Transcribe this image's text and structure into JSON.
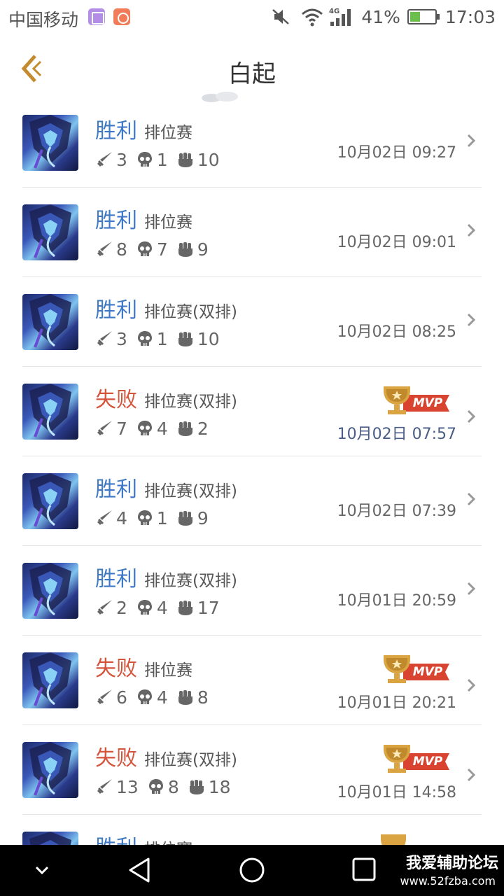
{
  "status_bar": {
    "carrier": "中国移动",
    "network": "4G",
    "battery": "41%",
    "battery_level": 0.41,
    "time": "17:03",
    "icons": [
      "gallery-icon",
      "rocket-icon",
      "mute-icon",
      "wifi-icon",
      "signal-icon",
      "battery-icon"
    ]
  },
  "header": {
    "title": "白起",
    "back_icon": "back-arrow-icon"
  },
  "colors": {
    "win": "#3f79c6",
    "loss": "#d4543c",
    "mvp_gold": "#d9a441",
    "mvp_red": "#d94431",
    "divider": "#e3e3e3"
  },
  "matches": [
    {
      "result": "胜利",
      "type": "win",
      "mode": "排位赛",
      "kills": "3",
      "deaths": "1",
      "assists": "10",
      "time": "10月02日 09:27",
      "mvp": false
    },
    {
      "result": "胜利",
      "type": "win",
      "mode": "排位赛",
      "kills": "8",
      "deaths": "7",
      "assists": "9",
      "time": "10月02日 09:01",
      "mvp": false
    },
    {
      "result": "胜利",
      "type": "win",
      "mode": "排位赛(双排)",
      "kills": "3",
      "deaths": "1",
      "assists": "10",
      "time": "10月02日 08:25",
      "mvp": false
    },
    {
      "result": "失败",
      "type": "loss",
      "mode": "排位赛(双排)",
      "kills": "7",
      "deaths": "4",
      "assists": "2",
      "time": "10月02日 07:57",
      "mvp": true,
      "mvp_label": "MVP"
    },
    {
      "result": "胜利",
      "type": "win",
      "mode": "排位赛(双排)",
      "kills": "4",
      "deaths": "1",
      "assists": "9",
      "time": "10月02日 07:39",
      "mvp": false
    },
    {
      "result": "胜利",
      "type": "win",
      "mode": "排位赛(双排)",
      "kills": "2",
      "deaths": "4",
      "assists": "17",
      "time": "10月01日 20:59",
      "mvp": false
    },
    {
      "result": "失败",
      "type": "loss",
      "mode": "排位赛",
      "kills": "6",
      "deaths": "4",
      "assists": "8",
      "time": "10月01日 20:21",
      "mvp": true,
      "mvp_label": "MVP"
    },
    {
      "result": "失败",
      "type": "loss",
      "mode": "排位赛(双排)",
      "kills": "13",
      "deaths": "8",
      "assists": "18",
      "time": "10月01日 14:58",
      "mvp": true,
      "mvp_label": "MVP"
    },
    {
      "result": "胜利",
      "type": "win",
      "mode": "排位赛",
      "partial": true
    }
  ],
  "nav_bar": {
    "icons": [
      "hide-nav-icon",
      "back-triangle-icon",
      "home-circle-icon",
      "recents-square-icon"
    ],
    "watermark_title": "我爱辅助论坛",
    "watermark_url": "www.52fzba.com"
  }
}
